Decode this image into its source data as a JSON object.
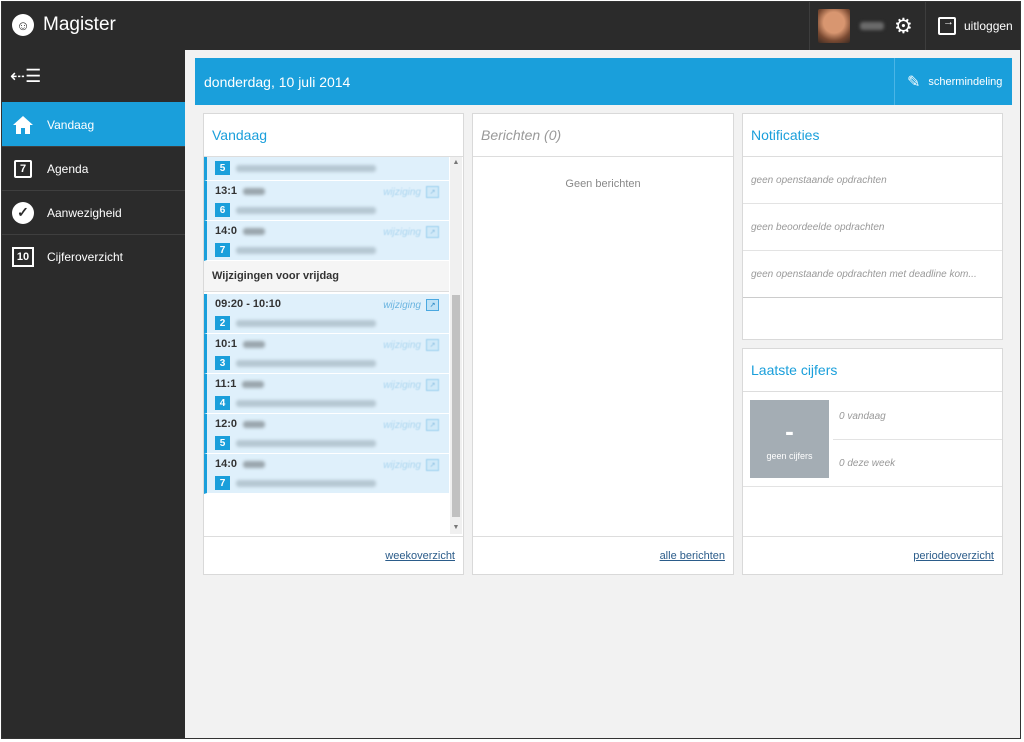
{
  "app": {
    "title": "Magister"
  },
  "topbar": {
    "logout_label": "uitloggen"
  },
  "sidebar": {
    "items": [
      {
        "label": "Vandaag",
        "icon": "home-icon",
        "active": true
      },
      {
        "label": "Agenda",
        "icon": "calendar-icon",
        "badge": "7"
      },
      {
        "label": "Aanwezigheid",
        "icon": "check-icon"
      },
      {
        "label": "Cijferoverzicht",
        "icon": "grades-icon",
        "badge": "10"
      }
    ]
  },
  "header": {
    "date": "donderdag, 10 juli 2014",
    "screen_layout_label": "schermindeling"
  },
  "today": {
    "title": "Vandaag",
    "lessons_top": [
      {
        "time": "",
        "hour": "5"
      },
      {
        "time": "13:1",
        "hour": "6"
      },
      {
        "time": "14:0",
        "hour": "7"
      }
    ],
    "section": "Wijzigingen voor vrijdag",
    "changes": [
      {
        "time": "09:20 - 10:10",
        "hour": "2",
        "tag": "wijziging"
      },
      {
        "time": "10:1",
        "hour": "3"
      },
      {
        "time": "11:1",
        "hour": "4"
      },
      {
        "time": "12:0",
        "hour": "5"
      },
      {
        "time": "14:0",
        "hour": "7"
      }
    ],
    "footer_link": "weekoverzicht"
  },
  "messages": {
    "title": "Berichten (0)",
    "empty": "Geen berichten",
    "footer_link": "alle berichten"
  },
  "notifications": {
    "title": "Notificaties",
    "items": [
      "geen openstaande opdrachten",
      "geen beoordeelde opdrachten",
      "geen openstaande opdrachten met deadline kom..."
    ]
  },
  "grades": {
    "title": "Laatste cijfers",
    "tile_value": "-",
    "tile_label": "geen cijfers",
    "today": "0 vandaag",
    "week": "0 deze week",
    "footer_link": "periodeoverzicht"
  },
  "colors": {
    "accent": "#1a9fdb",
    "sidebar": "#2b2b2b",
    "lesson_bg": "#dff0fb"
  }
}
